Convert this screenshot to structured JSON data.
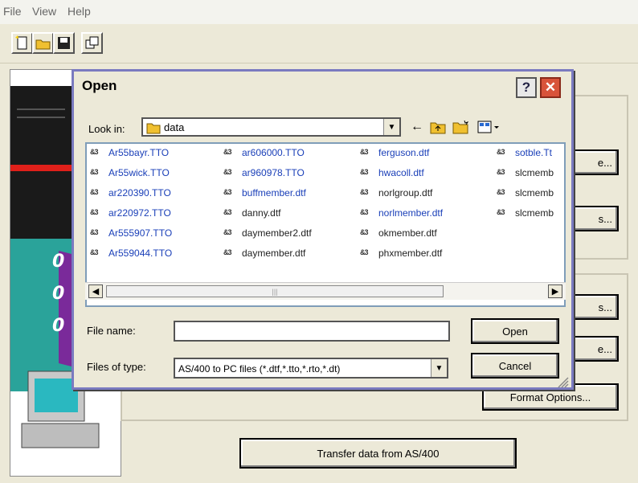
{
  "menubar": {
    "items": [
      "File",
      "View",
      "Help"
    ]
  },
  "toolbar": {
    "buttons": [
      "new-icon",
      "open-folder-icon",
      "save-icon",
      "properties-icon"
    ]
  },
  "background": {
    "partial_labels": [
      "e...",
      "s...",
      "s...",
      "e..."
    ],
    "format_options_label": "Format Options...",
    "transfer_button_label": "Transfer data from AS/400"
  },
  "dialog": {
    "title": "Open",
    "help_label": "?",
    "close_label": "✕",
    "look_in_label": "Look in:",
    "look_in_value": "data",
    "file_name_label": "File name:",
    "file_name_value": "",
    "files_of_type_label": "Files of type:",
    "files_of_type_value": "AS/400 to PC files (*.dtf,*.tto,*.rto,*.dt)",
    "open_button": "Open",
    "cancel_button": "Cancel",
    "files": [
      [
        "Ar55bayr.TTO",
        "Ar55wick.TTO",
        "ar220390.TTO",
        "ar220972.TTO",
        "Ar555907.TTO",
        "Ar559044.TTO"
      ],
      [
        "ar606000.TTO",
        "ar960978.TTO",
        "buffmember.dtf",
        "danny.dtf",
        "daymember2.dtf",
        "daymember.dtf"
      ],
      [
        "ferguson.dtf",
        "hwacoll.dtf",
        "norlgroup.dtf",
        "norlmember.dtf",
        "okmember.dtf",
        "phxmember.dtf"
      ],
      [
        "sotble.Tt",
        "slcmemb",
        "slcmemb",
        "slcmemb"
      ]
    ],
    "file_colors": [
      [
        "blue",
        "blue",
        "blue",
        "blue",
        "blue",
        "blue"
      ],
      [
        "blue",
        "blue",
        "blue",
        "black",
        "black",
        "black"
      ],
      [
        "blue",
        "blue",
        "black",
        "blue",
        "black",
        "black"
      ],
      [
        "blue",
        "black",
        "black",
        "black"
      ]
    ],
    "file_icon_text": "&3"
  }
}
